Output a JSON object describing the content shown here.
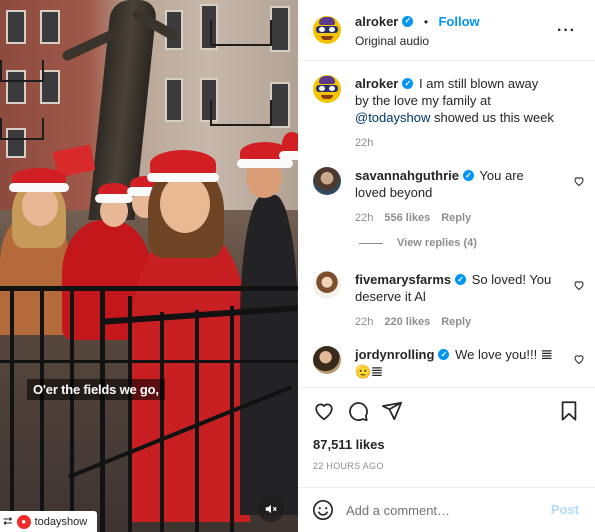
{
  "video": {
    "subtitle": "O'er the fields we go,",
    "repost_icon": "repost-icon",
    "repost_account": "todayshow",
    "mute_icon": "speaker-muted-icon"
  },
  "header": {
    "username": "alroker",
    "separator": "•",
    "follow_label": "Follow",
    "audio_label": "Original audio",
    "more_icon": "more-options-icon"
  },
  "caption": {
    "username": "alroker",
    "text_before": "I am still blown away by the love my family at ",
    "mention": "@todayshow",
    "text_after": " showed us this week",
    "time": "22h"
  },
  "comments": [
    {
      "username": "savannahguthrie",
      "text": "You are loved beyond",
      "time": "22h",
      "likes": "556 likes",
      "reply_label": "Reply"
    },
    {
      "username": "fivemarysfarms",
      "text": "So loved! You deserve it Al",
      "time": "22h",
      "likes": "220 likes",
      "reply_label": "Reply"
    },
    {
      "username": "jordynrolling",
      "text": "We love you!!! 𝌆 🫡𝌆"
    }
  ],
  "view_replies": "View replies (4)",
  "actions": {
    "like_icon": "heart-icon",
    "comment_icon": "comment-icon",
    "share_icon": "share-icon",
    "save_icon": "bookmark-icon"
  },
  "likes_count": "87,511 likes",
  "posted_ago": "22 HOURS AGO",
  "add_comment": {
    "placeholder": "Add a comment…",
    "post_label": "Post"
  },
  "colors": {
    "accent": "#0095f6",
    "post_disabled": "#b3dbff",
    "muted_text": "#8e8e8e"
  }
}
